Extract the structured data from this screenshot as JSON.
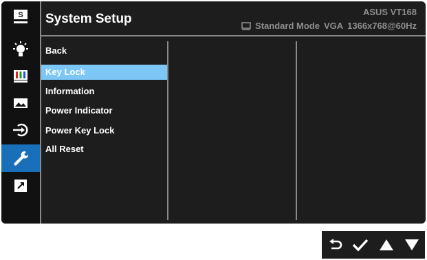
{
  "header": {
    "title": "System Setup",
    "model": "ASUS VT168",
    "mode": "Standard Mode",
    "input": "VGA",
    "resolution": "1366x768@60Hz"
  },
  "sidebar": {
    "items": [
      {
        "icon": "splendid-icon"
      },
      {
        "icon": "blue-light-filter-icon"
      },
      {
        "icon": "color-icon"
      },
      {
        "icon": "image-icon"
      },
      {
        "icon": "input-select-icon"
      },
      {
        "icon": "system-setup-icon",
        "active": true
      },
      {
        "icon": "shortcut-icon"
      }
    ]
  },
  "menu": {
    "items": [
      "Back",
      "Key Lock",
      "Information",
      "Power Indicator",
      "Power Key Lock",
      "All Reset"
    ],
    "selected": "Key Lock"
  },
  "nav": {
    "buttons": [
      "back-icon",
      "confirm-icon",
      "up-icon",
      "down-icon"
    ]
  },
  "colors": {
    "background": "#1d1d1d",
    "sidebar": "#111111",
    "active": "#1a6fb9",
    "selected": "#7cc7f6",
    "text": "#ffffff",
    "muted": "#8e8e8e"
  }
}
